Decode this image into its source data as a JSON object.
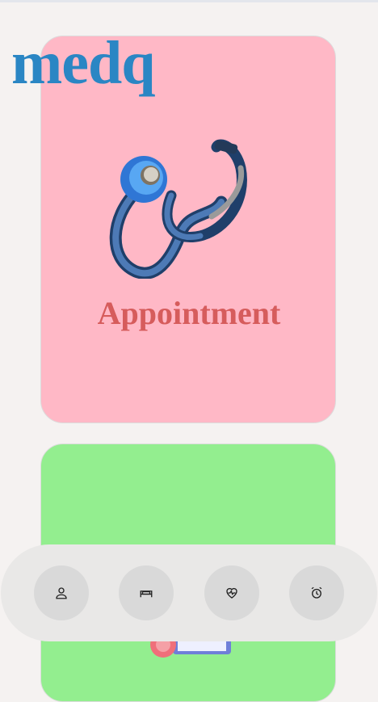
{
  "app": {
    "logo_text": "medq"
  },
  "cards": [
    {
      "title": "Appointment",
      "image": "stethoscope",
      "background": "#ffb8c6",
      "title_color": "#d65c5c"
    },
    {
      "image": "pill-calendar",
      "background": "#93ee8f"
    }
  ],
  "bottom_nav": {
    "items": [
      {
        "icon": "person-icon"
      },
      {
        "icon": "bed-icon"
      },
      {
        "icon": "heart-pulse-icon"
      },
      {
        "icon": "alarm-clock-icon"
      }
    ]
  },
  "colors": {
    "logo": "#2a86c4",
    "page_bg": "#f5f2f1",
    "nav_bg": "#e9e8e7",
    "nav_button": "#d9d9d9"
  }
}
